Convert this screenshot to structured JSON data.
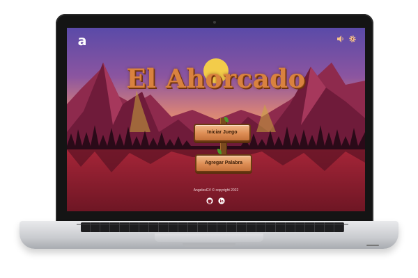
{
  "app": {
    "brand_letter": "a",
    "title": "El Ahorcado"
  },
  "actions": {
    "start_label": "Iniciar Juego",
    "add_word_label": "Agregar Palabra"
  },
  "toolbar": {
    "icons": [
      "volume-icon",
      "settings-gear-icon"
    ]
  },
  "footer": {
    "copyright": "AngelesGV © copyright 2022",
    "social_icons": [
      "github-icon",
      "linkedin-icon"
    ]
  },
  "colors": {
    "sky_top": "#5a4aa8",
    "sun": "#f3cc4a",
    "mountain": "#7a1f3f",
    "ground": "#8a1c2c",
    "title": "#d9823f",
    "button": "#dd8d54"
  }
}
